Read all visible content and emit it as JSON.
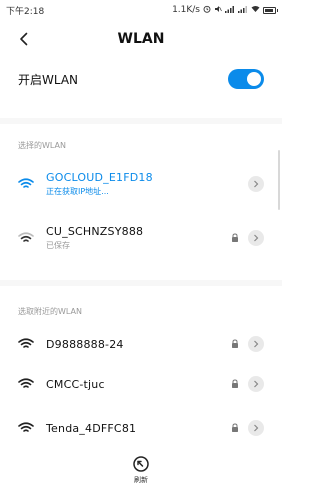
{
  "status_bar": {
    "time": "下午2:18",
    "speed": "1.1K/s",
    "battery_level": 0.85
  },
  "header": {
    "title": "WLAN"
  },
  "toggle": {
    "label": "开启WLAN",
    "on": true
  },
  "sections": {
    "selected_header": "选择的WLAN",
    "nearby_header": "选取附近的WLAN"
  },
  "selected_networks": [
    {
      "name": "GOCLOUD_E1FD18",
      "status": "正在获取IP地址...",
      "locked": false,
      "active": true
    },
    {
      "name": "CU_SCHNZSY888",
      "status": "已保存",
      "locked": true,
      "active": false
    }
  ],
  "nearby_networks": [
    {
      "name": "D9888888-24",
      "locked": true
    },
    {
      "name": "CMCC-tjuc",
      "locked": true
    },
    {
      "name": "Tenda_4DFFC81",
      "locked": true
    }
  ],
  "footer": {
    "refresh_label": "刷新"
  },
  "colors": {
    "accent": "#0b8bea",
    "muted_text": "#999999",
    "divider": "#f7f7f7"
  },
  "icons": {
    "back": "back-arrow-icon",
    "wifi": "wifi-icon",
    "lock": "lock-icon",
    "chevron": "chevron-right-icon",
    "refresh": "refresh-icon"
  }
}
